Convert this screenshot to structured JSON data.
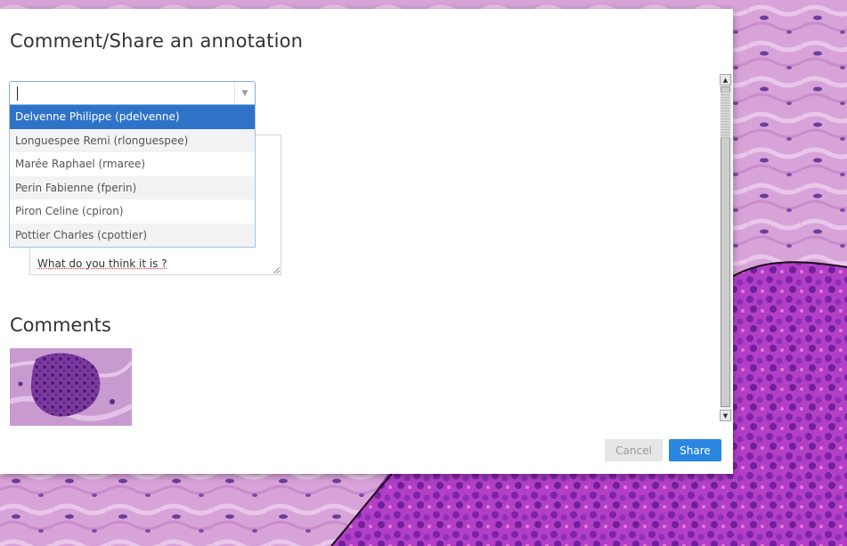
{
  "dialog": {
    "title": "Comment/Share an annotation",
    "user_select": {
      "value": "",
      "options": [
        "Delvenne Philippe (pdelvenne)",
        "Longuespee Remi (rlonguespee)",
        "Marée Raphael (rmaree)",
        "Perin Fabienne (fperin)",
        "Piron Celine (cpiron)",
        "Pottier Charles (cpottier)"
      ],
      "highlighted_index": 0
    },
    "message_text": "What do you think it is ?",
    "comments_heading": "Comments",
    "buttons": {
      "cancel": "Cancel",
      "share": "Share"
    }
  },
  "icons": {
    "combo_arrow": "chevron-down-icon",
    "scroll_up": "arrow-up-icon",
    "scroll_down": "arrow-down-icon"
  },
  "colors": {
    "accent": "#2a86e0",
    "selected_option": "#2f73c9",
    "tissue_pink": "#d59ad6",
    "tissue_purple": "#a93fc4"
  }
}
